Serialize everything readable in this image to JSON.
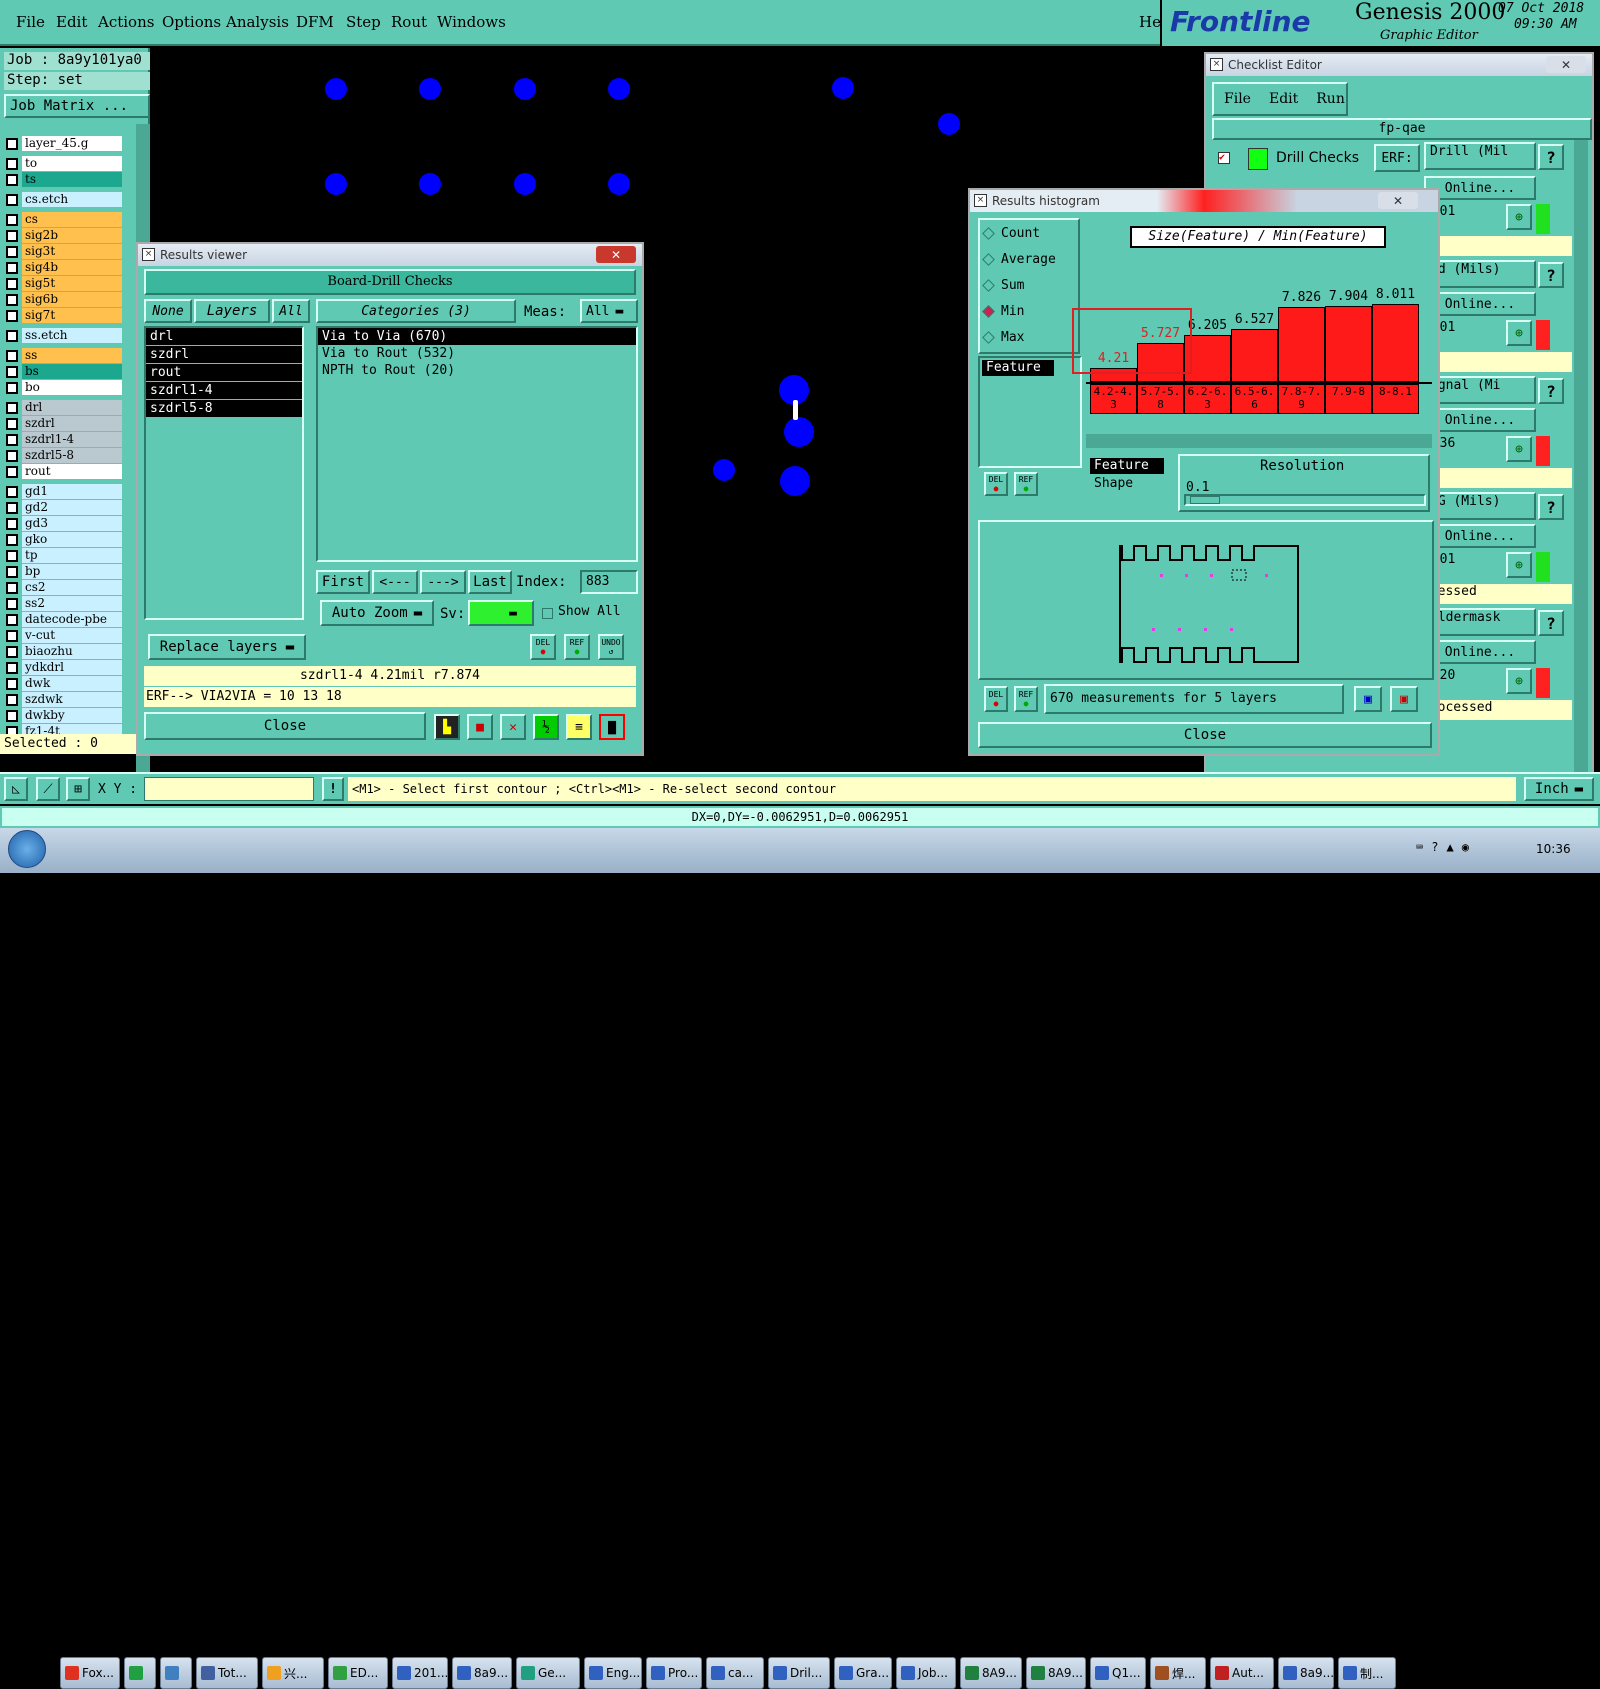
{
  "menu": {
    "items": [
      "File",
      "Edit",
      "Actions",
      "Options",
      "Analysis",
      "DFM",
      "Step",
      "Rout",
      "Windows"
    ],
    "help": "Help"
  },
  "brand": {
    "logo": "Frontline",
    "product": "Genesis 2000",
    "subtitle": "Graphic Editor",
    "date": "07 Oct 2018",
    "time": "09:30 AM"
  },
  "left_panel": {
    "job": "Job : 8a9y101ya0",
    "step": "Step: set",
    "job_matrix": "Job Matrix ...",
    "selected": "Selected : 0",
    "layers": [
      {
        "name": "layer_45.g",
        "color": "#ffffff"
      },
      {
        "name": "to",
        "color": "#ffffff"
      },
      {
        "name": "ts",
        "color": "#1ba88e"
      },
      {
        "name": "cs.etch",
        "color": "#c9f0ff"
      },
      {
        "name": "cs",
        "color": "#ffc04d"
      },
      {
        "name": "sig2b",
        "color": "#ffc04d"
      },
      {
        "name": "sig3t",
        "color": "#ffc04d"
      },
      {
        "name": "sig4b",
        "color": "#ffc04d"
      },
      {
        "name": "sig5t",
        "color": "#ffc04d"
      },
      {
        "name": "sig6b",
        "color": "#ffc04d"
      },
      {
        "name": "sig7t",
        "color": "#ffc04d"
      },
      {
        "name": "ss.etch",
        "color": "#c9f0ff"
      },
      {
        "name": "ss",
        "color": "#ffc04d"
      },
      {
        "name": "bs",
        "color": "#1ba88e"
      },
      {
        "name": "bo",
        "color": "#ffffff"
      },
      {
        "name": "drl",
        "color": "#b9c9cf"
      },
      {
        "name": "szdrl",
        "color": "#b9c9cf"
      },
      {
        "name": "szdrl1-4",
        "color": "#b9c9cf"
      },
      {
        "name": "szdrl5-8",
        "color": "#b9c9cf"
      },
      {
        "name": "rout",
        "color": "#ffffff"
      },
      {
        "name": "gd1",
        "color": "#c9f0ff"
      },
      {
        "name": "gd2",
        "color": "#c9f0ff"
      },
      {
        "name": "gd3",
        "color": "#c9f0ff"
      },
      {
        "name": "gko",
        "color": "#c9f0ff"
      },
      {
        "name": "tp",
        "color": "#c9f0ff"
      },
      {
        "name": "bp",
        "color": "#c9f0ff"
      },
      {
        "name": "cs2",
        "color": "#c9f0ff"
      },
      {
        "name": "ss2",
        "color": "#c9f0ff"
      },
      {
        "name": "datecode-pbe",
        "color": "#c9f0ff"
      },
      {
        "name": "v-cut",
        "color": "#c9f0ff"
      },
      {
        "name": "biaozhu",
        "color": "#c9f0ff"
      },
      {
        "name": "ydkdrl",
        "color": "#c9f0ff"
      },
      {
        "name": "dwk",
        "color": "#c9f0ff"
      },
      {
        "name": "szdwk",
        "color": "#c9f0ff"
      },
      {
        "name": "dwkby",
        "color": "#c9f0ff"
      },
      {
        "name": "fz1-4t",
        "color": "#c9f0ff"
      }
    ]
  },
  "results_viewer": {
    "title": "Results viewer",
    "close_x": "✕",
    "header": "Board-Drill Checks",
    "none": "None",
    "layers_btn": "Layers",
    "all_btn": "All",
    "categories": "Categories (3)",
    "meas_label": "Meas:",
    "meas_value": "All",
    "layer_list": [
      "drl",
      "szdrl",
      "rout",
      "szdrl1-4",
      "szdrl5-8"
    ],
    "category_list": [
      "Via to Via  (670)",
      "Via to Rout  (532)",
      "NPTH to Rout  (20)"
    ],
    "first": "First",
    "prev": "<---",
    "next": "--->",
    "last": "Last",
    "index_label": "Index:",
    "index_value": "883",
    "auto_zoom": "Auto Zoom",
    "sv_label": "Sv:",
    "show_all": "Show All",
    "replace_layers": "Replace layers",
    "del": "DEL",
    "ref": "REF",
    "undo": "UNDO",
    "status1": "szdrl1-4 4.21mil  r7.874",
    "status2": "ERF--> VIA2VIA = 10 13 18",
    "close": "Close"
  },
  "histogram": {
    "title": "Results histogram",
    "close_x": "✕",
    "options": [
      "Count",
      "Average",
      "Sum",
      "Min",
      "Max"
    ],
    "selected_option": "Min",
    "axis_title": "Size(Feature) / Min(Feature)",
    "feature": "Feature",
    "feature_list": [
      "Feature",
      "Shape"
    ],
    "resolution_label": "Resolution",
    "resolution_value": "0.1",
    "del": "DEL",
    "ref": "REF",
    "measurements": "670 measurements for 5 layers",
    "close": "Close",
    "chart_data": {
      "type": "bar",
      "categories": [
        "4.2-4.3",
        "5.7-5.8",
        "6.2-6.3",
        "6.5-6.6",
        "7.8-7.9",
        "7.9-8",
        "8-8.1"
      ],
      "labels": [
        "4.21",
        "5.727",
        "6.205",
        "6.527",
        "7.826",
        "7.904",
        "8.011"
      ],
      "values": [
        4.21,
        5.727,
        6.205,
        6.527,
        7.826,
        7.904,
        8.011
      ],
      "bar_color": "#ff1a1a",
      "highlight": [
        "4.21",
        "5.727"
      ]
    }
  },
  "checklist": {
    "title": "Checklist Editor",
    "close_x": "✕",
    "menu": [
      "File",
      "Edit",
      "Run"
    ],
    "name": "fp-qae",
    "drill_checks": "Drill Checks",
    "erf_label": "ERF:",
    "erf_value": "Drill (Mil",
    "online": "Online...",
    "q": "?",
    "rows": [
      {
        "erf": "Drill (Mil",
        "time": "0:01",
        "status": ""
      },
      {
        "erf": "cd (Mils)",
        "time": "0:01",
        "status": ""
      },
      {
        "erf": "ignal (Mi",
        "time": "0:36",
        "status": ""
      },
      {
        "erf": "/G (Mils)",
        "time": "0:01",
        "status": "ocessed"
      },
      {
        "erf": "oldermask",
        "time": "0:20",
        "status": "processed"
      }
    ]
  },
  "bottom": {
    "xy_label": "X Y :",
    "xy_value": "",
    "prompt": "<M1> - Select first contour ; <Ctrl><M1> - Re-select second contour",
    "units": "Inch",
    "measure": "DX=0,DY=-0.0062951,D=0.0062951"
  },
  "taskbar": {
    "items": [
      "Fox...",
      "",
      "",
      "Tot...",
      "兴...",
      "ED...",
      "201...",
      "8a9...",
      "Ge...",
      "Eng...",
      "Pro...",
      "ca...",
      "Dril...",
      "Gra...",
      "Job...",
      "8A9...",
      "8A9...",
      "Q1...",
      "焊...",
      "Aut...",
      "8a9...",
      "制..."
    ],
    "clock": "10:36"
  }
}
